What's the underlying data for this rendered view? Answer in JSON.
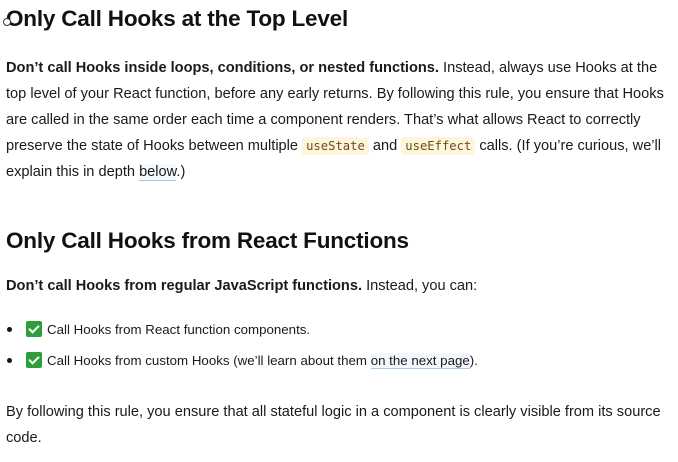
{
  "section1": {
    "heading": "Only Call Hooks at the Top Level",
    "bold_lead": "Don’t call Hooks inside loops, conditions, or nested functions.",
    "text_a": " Instead, always use Hooks at the top level of your React function, before any early returns. By following this rule, you ensure that Hooks are called in the same order each time a component renders. That’s what allows React to correctly preserve the state of Hooks between multiple ",
    "code1": "useState",
    "text_b": " and ",
    "code2": "useEffect",
    "text_c": " calls. (If you’re curious, we’ll explain this in depth ",
    "link": "below",
    "text_d": ".)"
  },
  "section2": {
    "heading": "Only Call Hooks from React Functions",
    "bold_lead": "Don’t call Hooks from regular JavaScript functions.",
    "text_a": " Instead, you can:",
    "items": [
      {
        "text": "Call Hooks from React function components."
      },
      {
        "text_before": "Call Hooks from custom Hooks (we’ll learn about them ",
        "link": "on the next page",
        "text_after": ")."
      }
    ],
    "closing": "By following this rule, you ensure that all stateful logic in a component is clearly visible from its source code."
  },
  "icons": {
    "check": "check-mark-icon",
    "anchor": "anchor-dot-icon"
  },
  "colors": {
    "check_green": "#2e9e3a",
    "code_bg": "#fdf5dc",
    "link_underline": "#a8c7e8"
  }
}
